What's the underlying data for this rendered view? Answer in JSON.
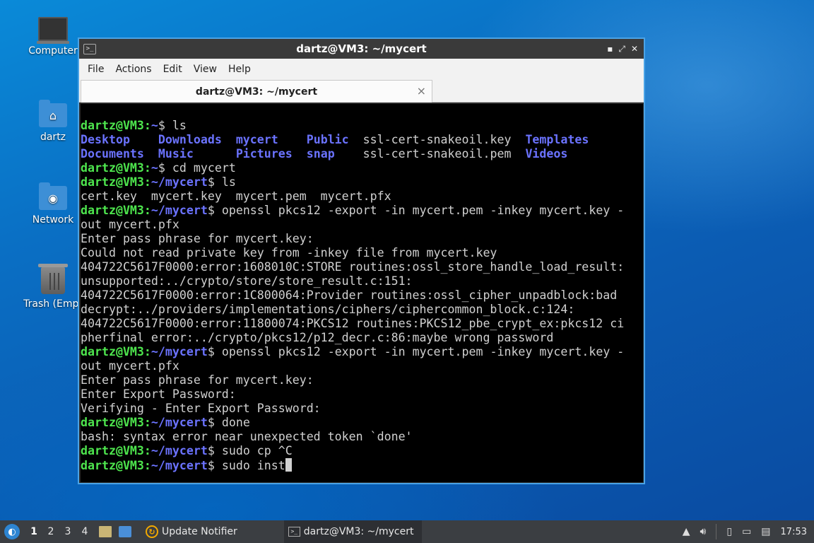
{
  "desktop": {
    "icons": [
      {
        "label": "Computer"
      },
      {
        "label": "dartz"
      },
      {
        "label": "Network"
      },
      {
        "label": "Trash (Empt"
      }
    ]
  },
  "window": {
    "title": "dartz@VM3: ~/mycert",
    "menu": [
      "File",
      "Actions",
      "Edit",
      "View",
      "Help"
    ],
    "tab_title": "dartz@VM3: ~/mycert",
    "tab_close": "×",
    "controls": {
      "minimize": "▪",
      "maximize": "⤢",
      "close": "✕"
    }
  },
  "terminal": {
    "prompt_user": "dartz@VM3",
    "lines": [
      {
        "kind": "prompt",
        "path": "~",
        "cmd": "ls"
      },
      {
        "kind": "ls",
        "cells": [
          {
            "t": "Desktop   ",
            "dir": true
          },
          {
            "t": " ",
            "dir": false
          },
          {
            "t": "Downloads ",
            "dir": true
          },
          {
            "t": " ",
            "dir": false
          },
          {
            "t": "mycert    ",
            "dir": true
          },
          {
            "t": "Public",
            "dir": true
          },
          {
            "t": "  ssl-cert-snakeoil.key  ",
            "dir": false
          },
          {
            "t": "Templates",
            "dir": true
          }
        ]
      },
      {
        "kind": "ls",
        "cells": [
          {
            "t": "Documents ",
            "dir": true
          },
          {
            "t": " ",
            "dir": false
          },
          {
            "t": "Music     ",
            "dir": true
          },
          {
            "t": " ",
            "dir": false
          },
          {
            "t": "Pictures  ",
            "dir": true
          },
          {
            "t": "snap  ",
            "dir": true
          },
          {
            "t": "  ssl-cert-snakeoil.pem  ",
            "dir": false
          },
          {
            "t": "Videos",
            "dir": true
          }
        ]
      },
      {
        "kind": "prompt",
        "path": "~",
        "cmd": "cd mycert"
      },
      {
        "kind": "prompt",
        "path": "~/mycert",
        "cmd": "ls"
      },
      {
        "kind": "text",
        "text": "cert.key  mycert.key  mycert.pem  mycert.pfx"
      },
      {
        "kind": "prompt",
        "path": "~/mycert",
        "cmd": "openssl pkcs12 -export -in mycert.pem -inkey mycert.key -"
      },
      {
        "kind": "text",
        "text": "out mycert.pfx"
      },
      {
        "kind": "text",
        "text": "Enter pass phrase for mycert.key:"
      },
      {
        "kind": "text",
        "text": "Could not read private key from -inkey file from mycert.key"
      },
      {
        "kind": "text",
        "text": "404722C5617F0000:error:1608010C:STORE routines:ossl_store_handle_load_result:"
      },
      {
        "kind": "text",
        "text": "unsupported:../crypto/store/store_result.c:151:"
      },
      {
        "kind": "text",
        "text": "404722C5617F0000:error:1C800064:Provider routines:ossl_cipher_unpadblock:bad"
      },
      {
        "kind": "text",
        "text": "decrypt:../providers/implementations/ciphers/ciphercommon_block.c:124:"
      },
      {
        "kind": "text",
        "text": "404722C5617F0000:error:11800074:PKCS12 routines:PKCS12_pbe_crypt_ex:pkcs12 ci"
      },
      {
        "kind": "text",
        "text": "pherfinal error:../crypto/pkcs12/p12_decr.c:86:maybe wrong password"
      },
      {
        "kind": "prompt",
        "path": "~/mycert",
        "cmd": "openssl pkcs12 -export -in mycert.pem -inkey mycert.key -"
      },
      {
        "kind": "text",
        "text": "out mycert.pfx"
      },
      {
        "kind": "text",
        "text": "Enter pass phrase for mycert.key:"
      },
      {
        "kind": "text",
        "text": "Enter Export Password:"
      },
      {
        "kind": "text",
        "text": "Verifying - Enter Export Password:"
      },
      {
        "kind": "prompt",
        "path": "~/mycert",
        "cmd": "done"
      },
      {
        "kind": "text",
        "text": "bash: syntax error near unexpected token `done'"
      },
      {
        "kind": "prompt",
        "path": "~/mycert",
        "cmd": "sudo cp ^C"
      },
      {
        "kind": "prompt",
        "path": "~/mycert",
        "cmd": "sudo inst",
        "cursor": true
      }
    ]
  },
  "taskbar": {
    "workspaces": [
      "1",
      "2",
      "3",
      "4"
    ],
    "active_workspace": "1",
    "tasks": [
      {
        "label": "Update Notifier"
      },
      {
        "label": "dartz@VM3: ~/mycert"
      }
    ],
    "clock": "17:53"
  }
}
